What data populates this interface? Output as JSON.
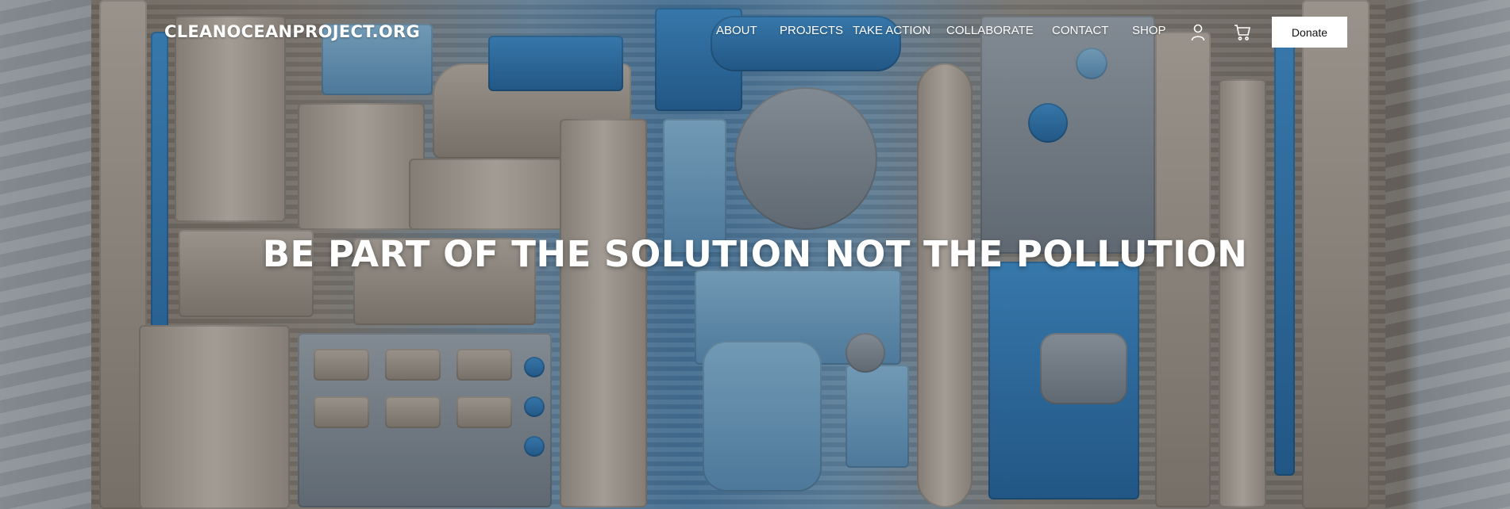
{
  "header": {
    "logo": "CLEANOCEANPROJECT.ORG",
    "nav": [
      {
        "label": "ABOUT"
      },
      {
        "label": "PROJECTS"
      },
      {
        "label": "TAKE ACTION"
      },
      {
        "label": "COLLABORATE"
      },
      {
        "label": "CONTACT"
      },
      {
        "label": "SHOP"
      }
    ],
    "account_icon": "account-icon",
    "cart_icon": "cart-icon",
    "donate_label": "Donate"
  },
  "hero": {
    "headline": "BE PART OF THE SOLUTION NOT THE POLLUTION",
    "background": "ocean-plastic-and-driftwood-artwork"
  },
  "colors": {
    "text": "#ffffff",
    "button_bg": "#ffffff",
    "button_text": "#111111",
    "accent_blue": "#3f8cc8"
  }
}
